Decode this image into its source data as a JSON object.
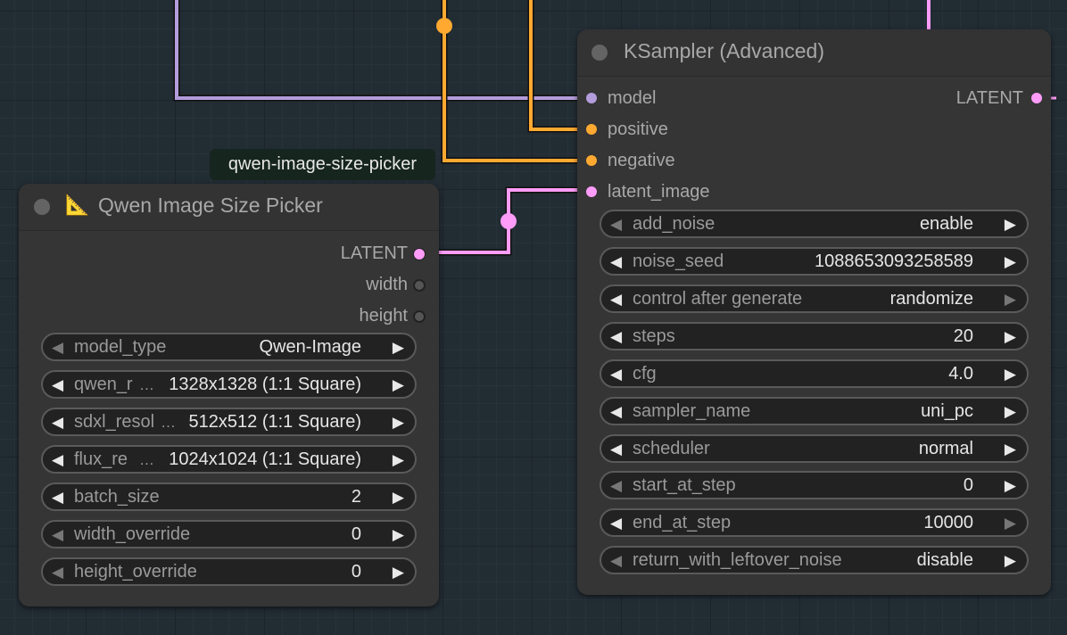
{
  "colors": {
    "model_link": "#b39ddb",
    "conditioning_link": "#ffa931",
    "latent_link": "#ff9cf9",
    "background": "#222c33",
    "node_body": "#353535"
  },
  "tooltip": {
    "text": "qwen-image-size-picker"
  },
  "qwen_node": {
    "title": "Qwen Image Size Picker",
    "title_icon": "📐",
    "title_icon_name": "triangular-ruler-icon",
    "outputs": [
      {
        "label": "LATENT",
        "type": "latent"
      },
      {
        "label": "width",
        "type": "int"
      },
      {
        "label": "height",
        "type": "int"
      }
    ],
    "widgets": [
      {
        "label": "model_type",
        "value": "Qwen-Image"
      },
      {
        "label": "qwen_r",
        "value": "1328x1328 (1:1 Square)"
      },
      {
        "label": "sdxl_resol",
        "value": "512x512 (1:1 Square)"
      },
      {
        "label": "flux_re",
        "value": "1024x1024 (1:1 Square)"
      },
      {
        "label": "batch_size",
        "value": "2"
      },
      {
        "label": "width_override",
        "value": "0"
      },
      {
        "label": "height_override",
        "value": "0"
      }
    ]
  },
  "ksampler_node": {
    "title": "KSampler (Advanced)",
    "inputs": [
      {
        "label": "model",
        "type": "model"
      },
      {
        "label": "positive",
        "type": "conditioning"
      },
      {
        "label": "negative",
        "type": "conditioning"
      },
      {
        "label": "latent_image",
        "type": "latent"
      }
    ],
    "outputs": [
      {
        "label": "LATENT",
        "type": "latent"
      }
    ],
    "widgets": [
      {
        "label": "add_noise",
        "value": "enable"
      },
      {
        "label": "noise_seed",
        "value": "1088653093258589"
      },
      {
        "label": "control after generate",
        "value": "randomize"
      },
      {
        "label": "steps",
        "value": "20"
      },
      {
        "label": "cfg",
        "value": "4.0"
      },
      {
        "label": "sampler_name",
        "value": "uni_pc"
      },
      {
        "label": "scheduler",
        "value": "normal"
      },
      {
        "label": "start_at_step",
        "value": "0"
      },
      {
        "label": "end_at_step",
        "value": "10000"
      },
      {
        "label": "return_with_leftover_noise",
        "value": "disable"
      }
    ]
  }
}
